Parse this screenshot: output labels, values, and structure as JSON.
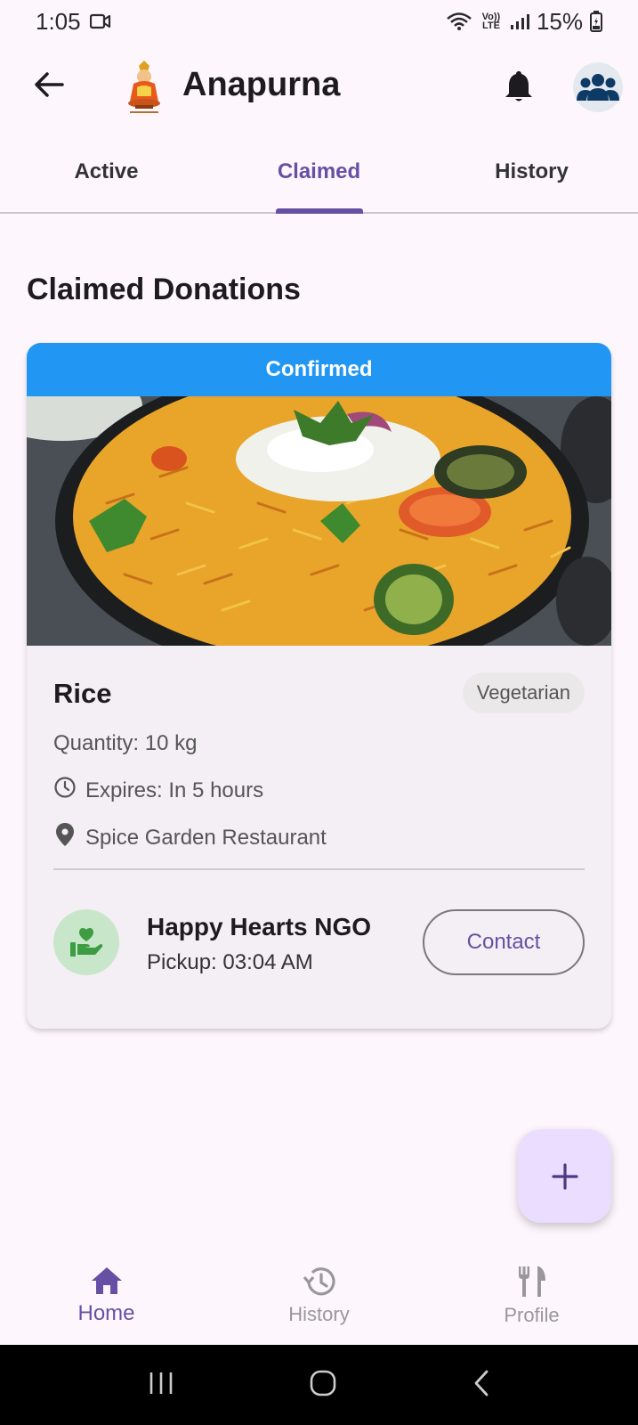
{
  "status_bar": {
    "time": "1:05",
    "battery": "15%",
    "network_label": "Vo)) LTE"
  },
  "app_bar": {
    "title": "Anapurna"
  },
  "tabs": [
    {
      "label": "Active",
      "selected": false
    },
    {
      "label": "Claimed",
      "selected": true
    },
    {
      "label": "History",
      "selected": false
    }
  ],
  "section_title": "Claimed Donations",
  "donation": {
    "status": "Confirmed",
    "status_color": "#2196F3",
    "food_name": "Rice",
    "tag": "Vegetarian",
    "quantity": "Quantity: 10 kg",
    "expires": "Expires: In 5 hours",
    "location": "Spice Garden Restaurant",
    "ngo_name": "Happy Hearts NGO",
    "pickup": "Pickup: 03:04 AM",
    "contact_label": "Contact"
  },
  "fab": {
    "icon": "plus-icon"
  },
  "bottom_nav": [
    {
      "label": "Home",
      "icon": "home-icon",
      "selected": true
    },
    {
      "label": "History",
      "icon": "history-icon",
      "selected": false
    },
    {
      "label": "Profile",
      "icon": "fork-knife-icon",
      "selected": false
    }
  ],
  "colors": {
    "accent": "#6750A4",
    "background": "#FDF7FD",
    "ngo_avatar_bg": "#C8E6C9",
    "fab_bg": "#EADDFF"
  }
}
